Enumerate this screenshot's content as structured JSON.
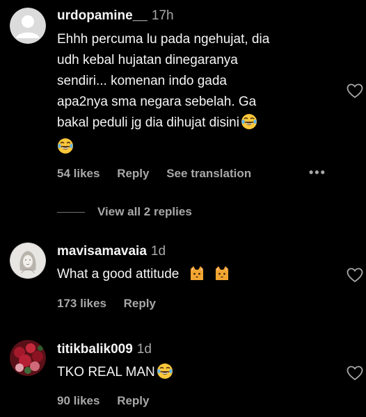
{
  "colors": {
    "background": "#000000",
    "primary_text": "#f5f5f5",
    "secondary_text": "#a8a8a8"
  },
  "comments": [
    {
      "username": "urdopamine__",
      "time": "17h",
      "lines": [
        "Ehhh percuma lu pada ngehujat, dia",
        "udh kebal hujatan dinegaranya",
        "sendiri... komenan indo gada",
        "apa2nya sma negara sebelah. Ga",
        "bakal peduli jg dia dihujat disini"
      ],
      "emojis": [
        "face-with-tears-of-joy",
        "face-with-tears-of-joy"
      ],
      "likes": "54 likes",
      "reply": "Reply",
      "translate": "See translation",
      "more": "•••",
      "view_replies": "View all 2 replies"
    },
    {
      "username": "mavisamavaia",
      "time": "1d",
      "text": "What a good attitude",
      "emojis": [
        "cat-face",
        "cat-face"
      ],
      "likes": "173 likes",
      "reply": "Reply"
    },
    {
      "username": "titikbalik009",
      "time": "1d",
      "text": "TKO REAL MAN",
      "emojis": [
        "face-with-tears-of-joy"
      ],
      "likes": "90 likes",
      "reply": "Reply"
    }
  ],
  "icons": {
    "like": "heart-outline-icon",
    "more": "more-options-icon",
    "avatar_default": "default-avatar-icon"
  }
}
